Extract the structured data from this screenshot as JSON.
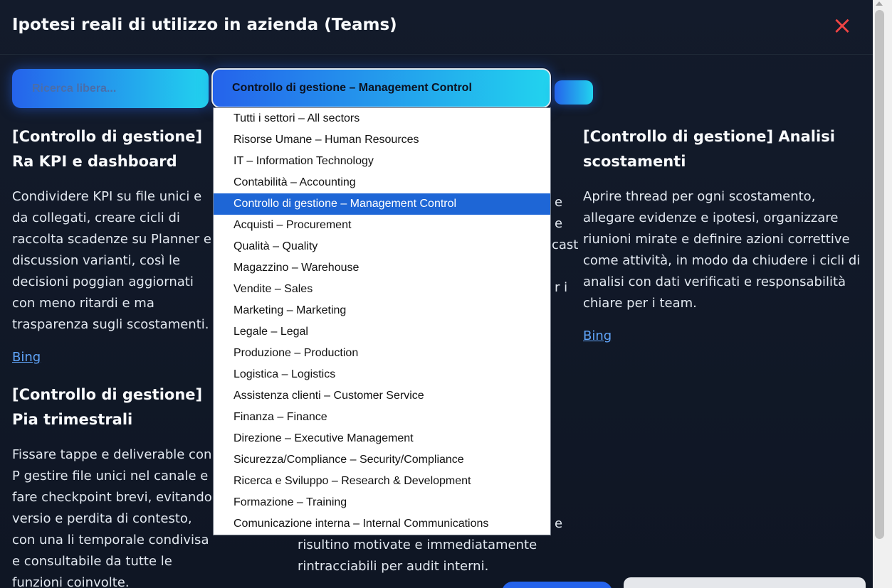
{
  "modal": {
    "title": "Ipotesi reali di utilizzo in azienda (Teams)",
    "close_icon": "×"
  },
  "search": {
    "placeholder": "Ricerca libera...",
    "value": ""
  },
  "sector_select": {
    "selected": "Controllo di gestione – Management Control"
  },
  "dropdown": {
    "options": [
      "Tutti i settori – All sectors",
      "Risorse Umane – Human Resources",
      "IT – Information Technology",
      "Contabilità – Accounting",
      "Controllo di gestione – Management Control",
      "Acquisti – Procurement",
      "Qualità – Quality",
      "Magazzino – Warehouse",
      "Vendite – Sales",
      "Marketing – Marketing",
      "Legale – Legal",
      "Produzione – Production",
      "Logistica – Logistics",
      "Assistenza clienti – Customer Service",
      "Finanza – Finance",
      "Direzione – Executive Management",
      "Sicurezza/Compliance – Security/Compliance",
      "Ricerca e Sviluppo – Research & Development",
      "Formazione – Training",
      "Comunicazione interna – Internal Communications"
    ],
    "selected_index": 4
  },
  "cards": [
    {
      "title": "[Controllo di gestione] Ra KPI e dashboard",
      "text": "Condividere KPI su file unici e da collegati, creare cicli di raccolta scadenze su Planner e discussion varianti, così le decisioni poggian aggiornati con meno ritardi e ma trasparenza sugli scostamenti.",
      "link": "Bing"
    },
    {
      "title": "[Controllo di gestione] Analisi scostamenti",
      "text": "Aprire thread per ogni scostamento, allegare evidenze e ipotesi, organizzare riunioni mirate e definire azioni correttive come attività, in modo da chiudere i cicli di analisi con dati verificati e responsabilità chiare per i team.",
      "link": "Bing"
    },
    {
      "title": "[Controllo di gestione] Pia trimestrali",
      "text": "Fissare tappe e deliverable con P gestire file unici nel canale e fare checkpoint brevi, evitando versio e perdita di contesto, con una li temporale condivisa e consultabile da tutte le funzioni coinvolte."
    }
  ],
  "middle_fragments": {
    "top_right": [
      "e",
      "e",
      "cast",
      "r i"
    ],
    "bottom": [
      "risultino motivate e immediatamente",
      "rintracciabili per audit interni."
    ],
    "bottom_edge": [
      "e",
      "e"
    ]
  },
  "colors": {
    "accent_start": "#2563eb",
    "accent_end": "#22d3ee",
    "close": "#ef4444",
    "link": "#60a5fa",
    "selected_option": "#1e66d6"
  }
}
